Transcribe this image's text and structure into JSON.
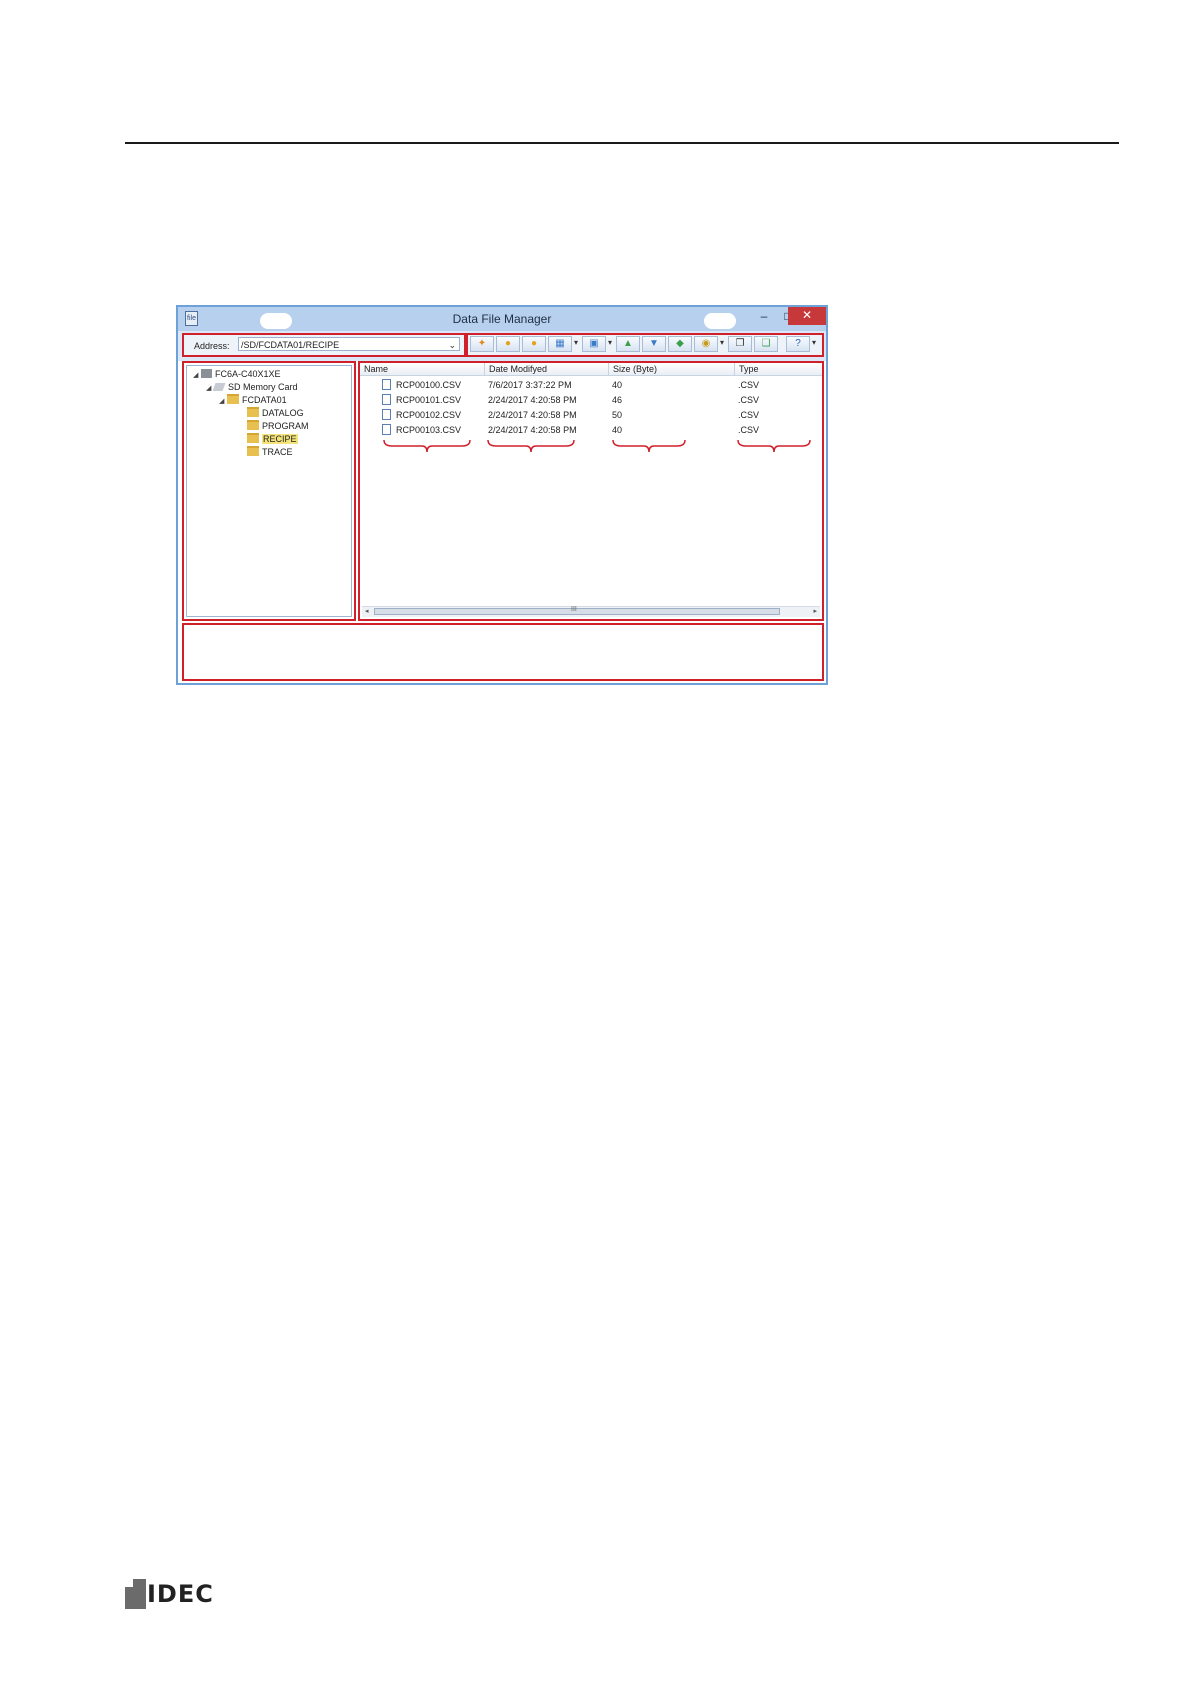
{
  "window": {
    "title": "Data File Manager",
    "app_icon_text": "file",
    "minimize": "–",
    "maximize": "□",
    "close": "✕"
  },
  "address": {
    "label": "Address:",
    "value": "/SD/FCDATA01/RECIPE"
  },
  "toolbar": {
    "buttons": [
      "refresh-icon",
      "connect-icon",
      "disconnect-icon",
      "view-icon",
      "layout-icon",
      "add-folder-icon",
      "download-icon",
      "upload-icon",
      "settings-icon",
      "copy-icon",
      "paste-icon",
      "help-icon"
    ]
  },
  "tree": {
    "root": "FC6A-C40X1XE",
    "card": "SD Memory Card",
    "folder": "FCDATA01",
    "children": [
      "DATALOG",
      "PROGRAM",
      "RECIPE",
      "TRACE"
    ],
    "selected": "RECIPE"
  },
  "list": {
    "columns": [
      "Name",
      "Date Modifyed",
      "Size (Byte)",
      "Type"
    ],
    "rows": [
      {
        "name": "RCP00100.CSV",
        "date": "7/6/2017 3:37:22 PM",
        "size": "40",
        "type": ".CSV"
      },
      {
        "name": "RCP00101.CSV",
        "date": "2/24/2017 4:20:58 PM",
        "size": "46",
        "type": ".CSV"
      },
      {
        "name": "RCP00102.CSV",
        "date": "2/24/2017 4:20:58 PM",
        "size": "50",
        "type": ".CSV"
      },
      {
        "name": "RCP00103.CSV",
        "date": "2/24/2017 4:20:58 PM",
        "size": "40",
        "type": ".CSV"
      }
    ]
  },
  "scrollbar": {
    "left": "◂",
    "grip": "III",
    "right": "▸"
  },
  "logo": {
    "text": "IDEC"
  },
  "colors": {
    "highlight": "#d0202c",
    "titlebar": "#b6d0ee",
    "selected": "#f4e27a"
  }
}
